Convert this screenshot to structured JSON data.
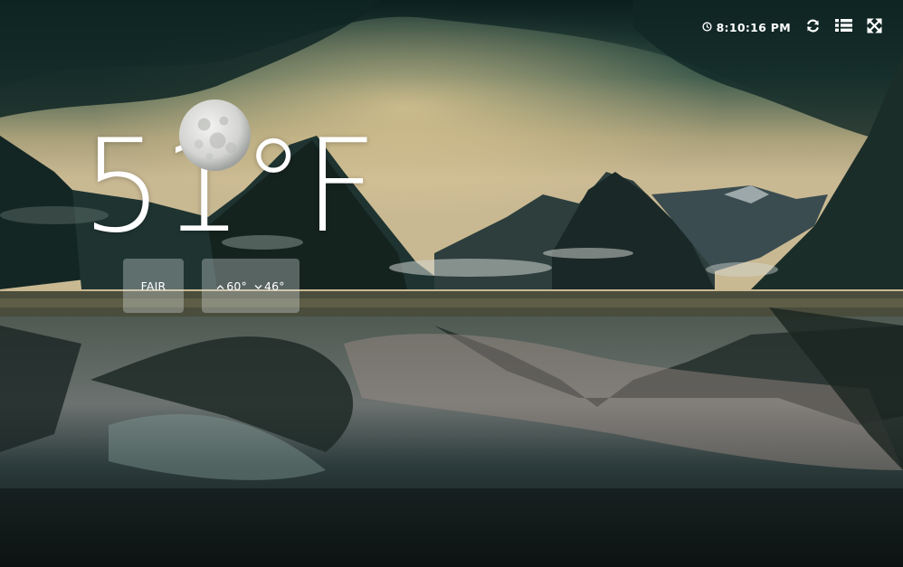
{
  "clock": {
    "time": "8:10:16 PM",
    "icon": "clock-icon"
  },
  "toolbar": {
    "refresh_icon": "refresh-icon",
    "list_icon": "list-icon",
    "fullscreen_icon": "fullscreen-icon"
  },
  "weather": {
    "temperature": "51°F",
    "condition": "FAIR",
    "high": "60°",
    "low": "46°",
    "high_icon": "chevron-up-icon",
    "low_icon": "chevron-down-icon",
    "moon_icon": "full-moon-icon"
  },
  "colors": {
    "text": "#ffffff",
    "box": "rgba(220,225,226,0.34)"
  }
}
